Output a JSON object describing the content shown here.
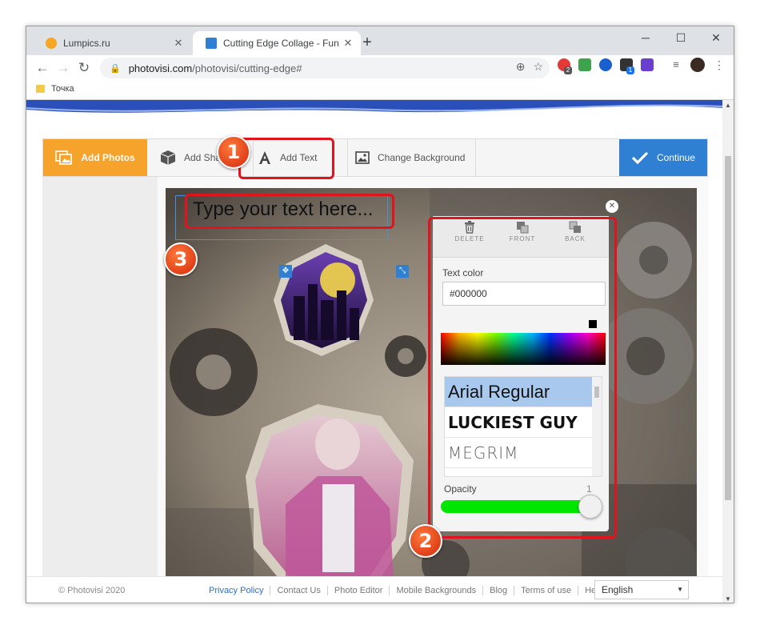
{
  "browser": {
    "tabs": [
      {
        "title": "Lumpics.ru",
        "favicon_color": "#f5a623"
      },
      {
        "title": "Cutting Edge Collage - Fun | Photo",
        "favicon_color": "#2f7fd2"
      }
    ],
    "new_tab_label": "+",
    "window_controls": {
      "minimize": "─",
      "maximize": "☐",
      "close": "✕"
    },
    "url_host": "photovisi.com",
    "url_path": "/photovisi/cutting-edge#",
    "bookmark": "Точка",
    "extension_badges": [
      "2",
      "1"
    ]
  },
  "app": {
    "toolbar": {
      "add_photos": "Add Photos",
      "add_shape": "Add Shape",
      "add_text": "Add Text",
      "change_background": "Change Background",
      "continue": "Continue"
    },
    "text_element": "Type your text here...",
    "panel": {
      "delete": "DELETE",
      "front": "FRONT",
      "back": "BACK",
      "text_color_label": "Text color",
      "text_color_value": "#000000",
      "fonts": [
        "Arial Regular",
        "LUCKIEST GUY",
        "MEGRIM"
      ],
      "selected_font": "Arial Regular",
      "opacity_label": "Opacity",
      "opacity_value": "1",
      "slider_color": "#00e600"
    },
    "callouts": [
      "1",
      "2",
      "3"
    ]
  },
  "footer": {
    "copyright": "© Photovisi 2020",
    "links": [
      "Privacy Policy",
      "Contact Us",
      "Photo Editor",
      "Mobile Backgrounds",
      "Blog",
      "Terms of use",
      "Help"
    ],
    "language": "English"
  },
  "colors": {
    "accent_orange": "#f6a32b",
    "accent_blue": "#2f7fd2",
    "highlight_red": "#e0141e"
  }
}
